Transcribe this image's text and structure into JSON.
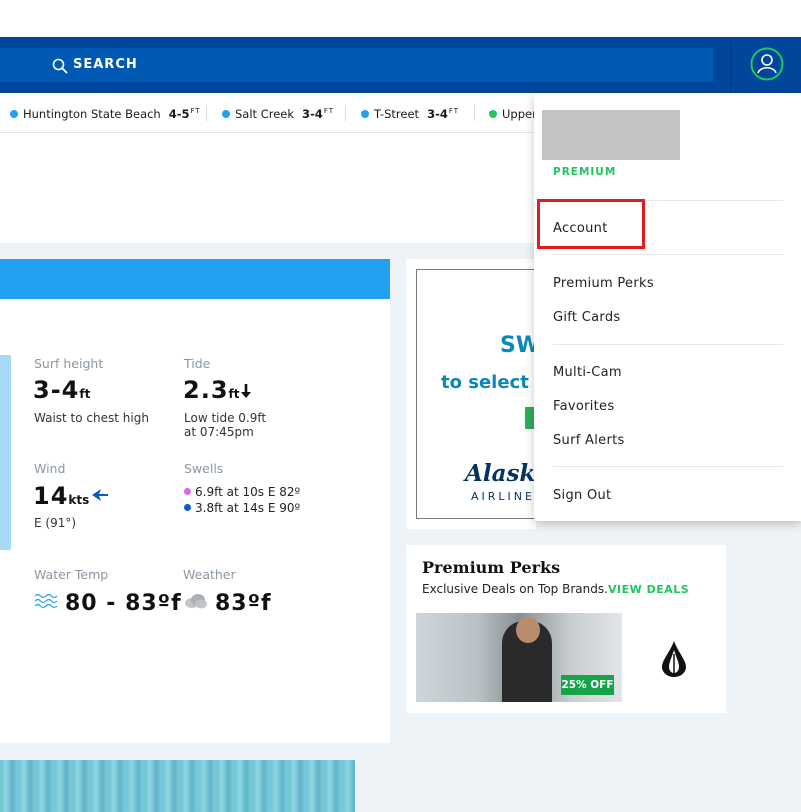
{
  "header": {
    "search_label": "SEARCH"
  },
  "ticker": [
    {
      "name": "Huntington State Beach",
      "height": "4-5",
      "unit": "FT",
      "color": "#22a1f2"
    },
    {
      "name": "Salt Creek",
      "height": "3-4",
      "unit": "FT",
      "color": "#22a1f2"
    },
    {
      "name": "T-Street",
      "height": "3-4",
      "unit": "FT",
      "color": "#22a1f2"
    },
    {
      "name": "Upper",
      "color": "#22c55e"
    }
  ],
  "conditions": {
    "surf": {
      "label": "Surf height",
      "value": "3-4",
      "unit": "ft",
      "desc": "Waist to chest high"
    },
    "tide": {
      "label": "Tide",
      "value": "2.3",
      "unit": "ft",
      "desc1": "Low tide 0.9ft",
      "desc2": "at 07:45pm"
    },
    "wind": {
      "label": "Wind",
      "value": "14",
      "unit": "kts",
      "desc": "E (91°)"
    },
    "swells": {
      "label": "Swells",
      "items": [
        {
          "text": "6.9ft at 10s E 82º",
          "color": "#d865e8"
        },
        {
          "text": "3.8ft at 14s E 90º",
          "color": "#0b5cc2"
        }
      ]
    },
    "water": {
      "label": "Water Temp",
      "value": "80 - 83ºf"
    },
    "weather": {
      "label": "Weather",
      "value": "83ºf"
    }
  },
  "ad": {
    "line1": "SW",
    "line2": "to select s",
    "brand": "Alask",
    "brand_sub": "AIRLINE"
  },
  "perks": {
    "title": "Premium Perks",
    "subtitle": "Exclusive Deals on Top Brands.",
    "link": "VIEW DEALS",
    "badge": "25% OFF"
  },
  "menu": {
    "tier": "PREMIUM",
    "items": {
      "account": "Account",
      "premium_perks": "Premium Perks",
      "gift_cards": "Gift Cards",
      "multi_cam": "Multi-Cam",
      "favorites": "Favorites",
      "surf_alerts": "Surf Alerts",
      "sign_out": "Sign Out"
    }
  },
  "colors": {
    "nav": "#00469b",
    "accent_blue": "#22a1f2",
    "green": "#22c55e",
    "highlight": "#e21c1c"
  }
}
